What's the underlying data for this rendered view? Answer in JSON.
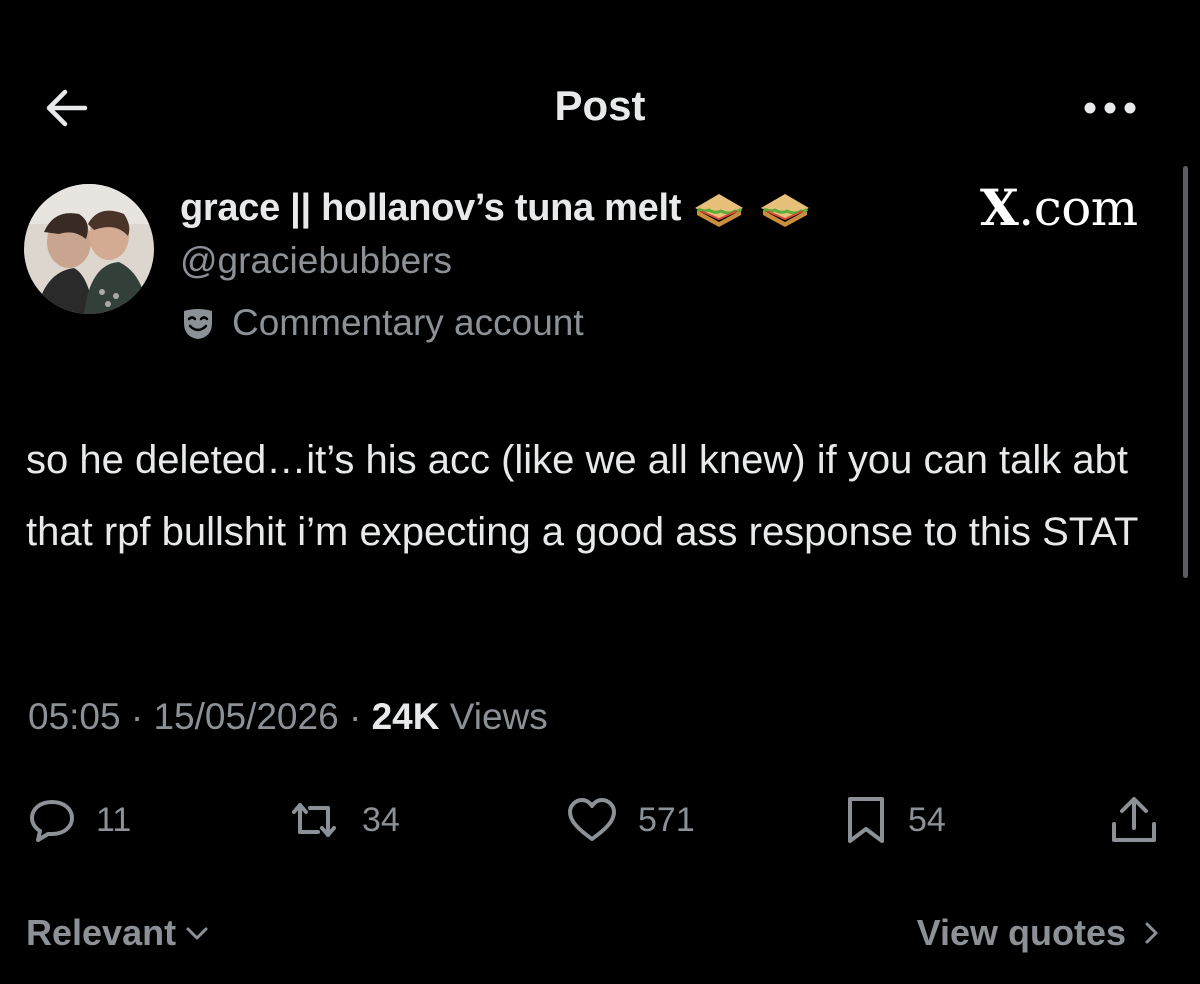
{
  "header": {
    "title": "Post",
    "back_icon": "arrow-left-icon",
    "more_icon": "more-horizontal-icon"
  },
  "author": {
    "display_name": "grace || hollanov’s tuna melt",
    "handle": "@graciebubbers",
    "label": "Commentary account",
    "label_icon": "theater-masks-icon"
  },
  "watermark": {
    "x": "X",
    "rest": ".com"
  },
  "post": {
    "text": "so he deleted…it’s his acc (like we all knew) if you can talk abt that rpf bullshit i’m expecting a good ass response to this STAT",
    "time": "05:05",
    "date": "15/05/2026",
    "sep": "·",
    "views_count": "24K",
    "views_label": "Views"
  },
  "actions": {
    "replies": "11",
    "reposts": "34",
    "likes": "571",
    "bookmarks": "54"
  },
  "footer": {
    "sort_label": "Relevant",
    "quotes_label": "View quotes"
  },
  "colors": {
    "background": "#000000",
    "primary_text": "#e7e9ea",
    "secondary_text": "#8b9196"
  }
}
